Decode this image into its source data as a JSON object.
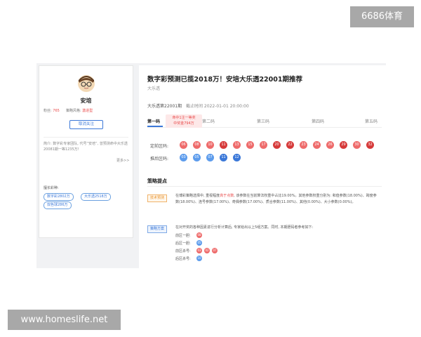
{
  "watermark_top": "6686体育",
  "watermark_bottom": "www.homeslife.net",
  "profile": {
    "name": "安培",
    "stats": {
      "rank_label": "粉丝:",
      "rank_value": "765",
      "style_label": "策略风格:",
      "style_value": "激进型"
    },
    "follow_label": "取消关注",
    "intro": "简介: 数字彩专家团队, 代号“安培”, 曾预测命中大乐透20081期一等1235万!",
    "more": "更多>>",
    "record_label": "擅长彩种:",
    "tags": [
      "数字彩2802万",
      "大乐透2518万",
      "双色球286万"
    ]
  },
  "article": {
    "title": "数字彩预测已揽2018万！安培大乐透22001期推荐",
    "author": "大乐透",
    "issue": "大乐透第22001期",
    "deadline": "截止时间 2022-01-01 20:00:00",
    "tabs": [
      "第一码",
      "第二码",
      "第三码",
      "第四码",
      "第五码"
    ],
    "tooltip": [
      "命中1注一等奖",
      "中奖金794万"
    ],
    "front_label": "定前区码:",
    "front_balls": [
      "06",
      "08",
      "10",
      "11",
      "13",
      "15",
      "17",
      "20",
      "22",
      "23",
      "24",
      "26",
      "29",
      "30",
      "32"
    ],
    "back_label": "推后区码:",
    "back_balls": [
      "03",
      "05",
      "07",
      "11",
      "12"
    ]
  },
  "strategy": {
    "section_title": "策略提点",
    "tag1": "技术预测",
    "text1_a": "在博彩策略选择中, 重视程度",
    "text1_hl": "高于点数",
    "text1_b": ", 该参数在当前算法权重中占比19.00%。其他参数权重分别为: 和值参数(18.00%)、跨度参数(18.00%)、连号参数(17.00%)、奇偶参数(17.00%)、质合参数(11.00%)、其他(0.00%)、大小参数(0.00%)。",
    "tag2": "策略方案",
    "text2": "在对开奖的各种因素进行分析计算后, 专家给出以上5组方案。同时, 本期胆码者参考如下:",
    "zones": [
      {
        "label": "前区一胆:",
        "balls": [
          "08"
        ],
        "color": "red"
      },
      {
        "label": "后区一胆:",
        "balls": [
          "05"
        ],
        "color": "blue"
      },
      {
        "label": "前区杀号:",
        "balls": [
          "03",
          "02",
          "07"
        ],
        "color": "red"
      },
      {
        "label": "后区杀号:",
        "balls": [
          "10"
        ],
        "color": "blue"
      }
    ]
  }
}
